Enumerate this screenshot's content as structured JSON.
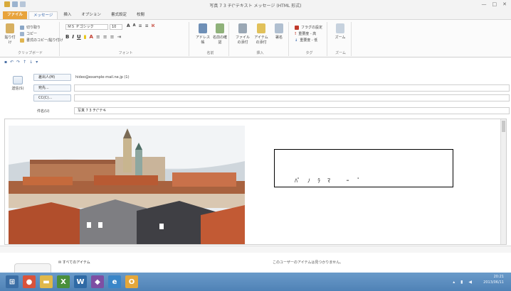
{
  "window": {
    "title": "写真 7 3 チ(\"テキスト メッセージ (HTML 形式)",
    "controls": [
      "—",
      "□",
      "✕"
    ]
  },
  "tabs": [
    {
      "label": "ファイル"
    },
    {
      "label": "メッセージ"
    },
    {
      "label": "挿入"
    },
    {
      "label": "オプション"
    },
    {
      "label": "書式設定"
    },
    {
      "label": "校閲"
    }
  ],
  "ribbon": {
    "paste_label": "貼り付け",
    "cut_label": "切り取り",
    "copy_label": "コピー",
    "format_painter_label": "書式のコピー/貼り付け",
    "clipboard_group": "クリップボード",
    "font_name": "ＭＳ Ｐゴシック",
    "font_size": "10",
    "basic_text_group": "フォント",
    "address_book_label": "アドレス帳",
    "check_names_label": "名前の確認",
    "names_group": "名前",
    "attach_file_label": "ファイルの添付",
    "attach_item_label": "アイテムの添付",
    "signature_label": "署名",
    "include_group": "挿入",
    "followup_label": "フラグの設定",
    "high_importance_label": "重要度 - 高",
    "low_importance_label": "重要度 - 低",
    "tags_group": "タグ",
    "zoom_label": "ズーム",
    "zoom_group": "ズーム"
  },
  "header": {
    "send_label": "送信(S)",
    "from_label": "差出人(M)",
    "from_value": "hideo@example-mail.ne.jp (1)",
    "to_label": "宛先...",
    "cc_label": "CC(C)...",
    "subject_label": "件名(U)",
    "subject_value": "写真 7 3 チ(\"テキ"
  },
  "body": {
    "textbox_text": "ﾊﾟﾉﾗﾏ  ｰ   ﾟ"
  },
  "people_pane": {
    "item_label": "すべてのアイテム",
    "status_text": "このユーザーのアイテムは見つかりません。"
  },
  "tray": {
    "time": "20:21",
    "date": "2013/06/11"
  },
  "colors": {
    "file_tab": "#e8a33b",
    "taskbar": "#5a8cc0"
  }
}
